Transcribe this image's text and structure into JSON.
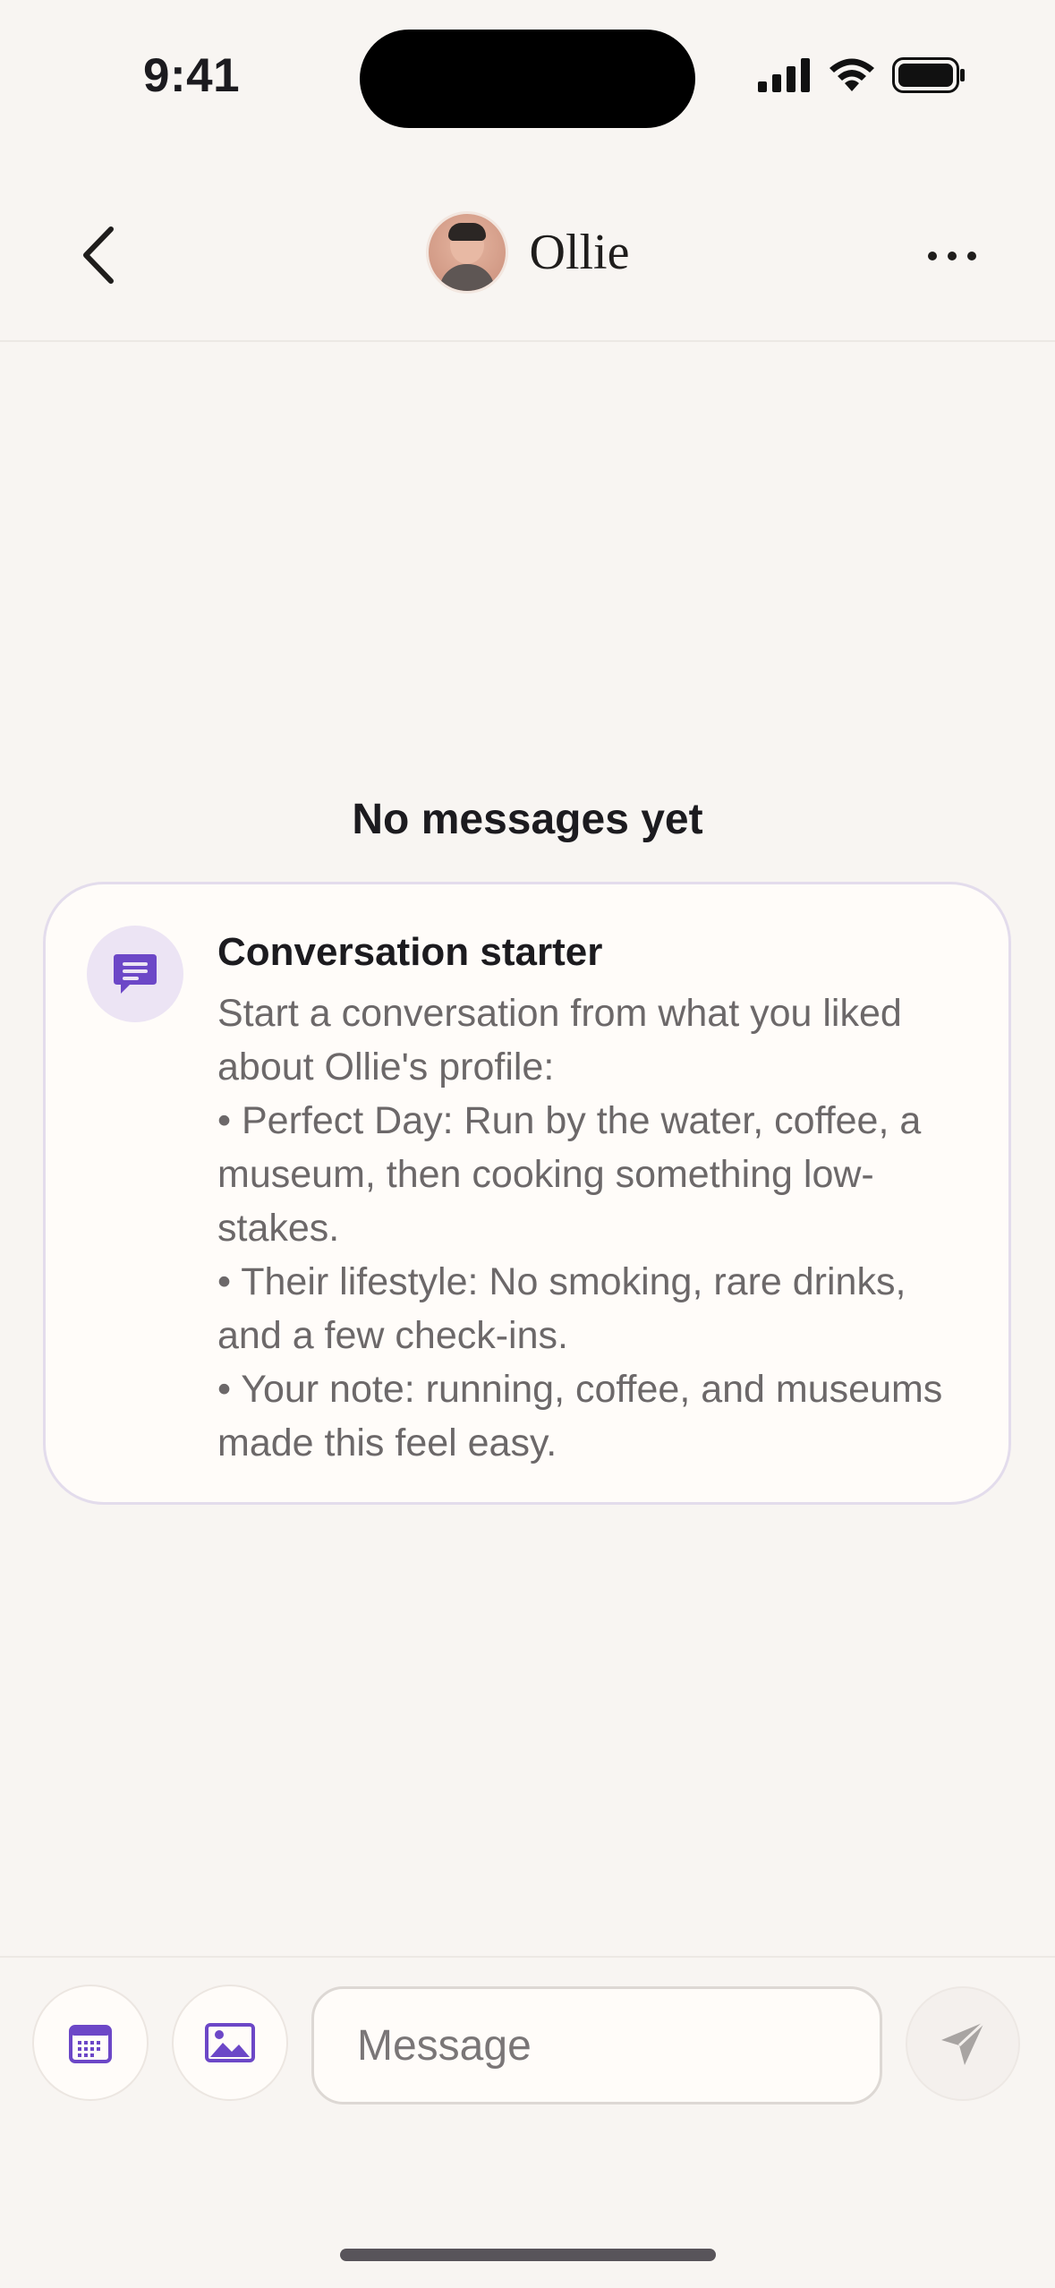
{
  "status_bar": {
    "time": "9:41"
  },
  "header": {
    "contact_name": "Ollie",
    "back_icon": "chevron-left-icon",
    "more_icon": "ellipsis-icon"
  },
  "empty_state": {
    "title": "No messages yet"
  },
  "conversation_starter": {
    "icon": "chat-bubble-icon",
    "title": "Conversation starter",
    "lines": [
      "Start a conversation from what you liked about Ollie's profile:",
      "• Perfect Day: Run by the water, coffee, a museum, then cooking something low-stakes.",
      "• Their lifestyle: No smoking, rare drinks, and a few check-ins.",
      "• Your note: running, coffee, and museums made this feel easy."
    ]
  },
  "composer": {
    "calendar_icon": "calendar-icon",
    "image_icon": "image-icon",
    "send_icon": "send-icon",
    "placeholder": "Message"
  },
  "colors": {
    "background": "#f8f5f2",
    "accent": "#6c47c7",
    "card_border": "#e3dcec",
    "icon_circle": "#ece4f4"
  }
}
